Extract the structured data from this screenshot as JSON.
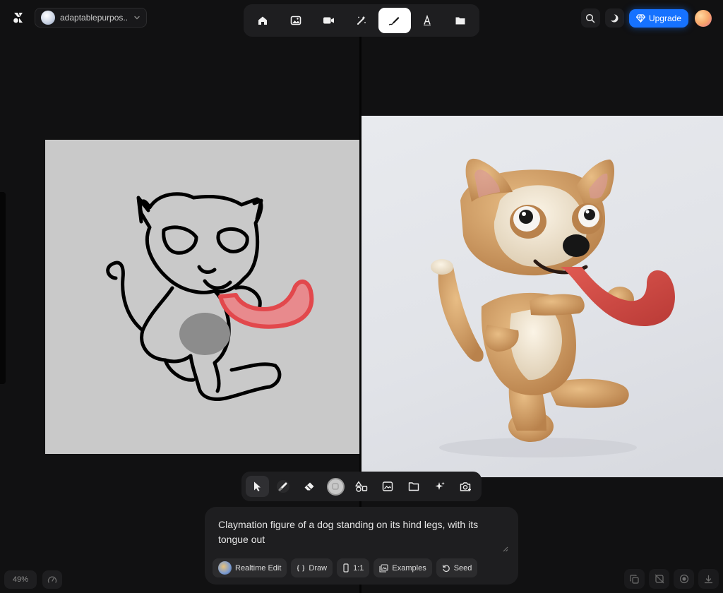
{
  "workspace": {
    "name": "adaptablepurpos..."
  },
  "mode_bar": {
    "active": "draw",
    "modes": [
      "home-icon",
      "image-icon",
      "video-icon",
      "magic-wand-icon",
      "draw-pen-icon",
      "font-icon",
      "folder-icon"
    ]
  },
  "header": {
    "upgrade_label": "Upgrade"
  },
  "colors": {
    "accent": "#1672ff",
    "background": "#111112",
    "panel": "#1e1e20",
    "sketch_canvas": "#c9c9c9",
    "sketch_tongue": "#e2484c"
  },
  "toolbar": {
    "active_tool": "select",
    "tools": [
      "cursor-icon",
      "brush-icon",
      "eraser-icon",
      "color-swatch",
      "shapes-icon",
      "image-upload-icon",
      "folder-icon",
      "sparkle-icon",
      "camera-icon"
    ]
  },
  "prompt": {
    "text": "Claymation figure of a dog standing on its hind legs, with its tongue out",
    "chips": {
      "realtime_edit": "Realtime Edit",
      "draw": "Draw",
      "aspect": "1:1",
      "examples": "Examples",
      "seed": "Seed"
    }
  },
  "zoom": {
    "level": "49%"
  }
}
